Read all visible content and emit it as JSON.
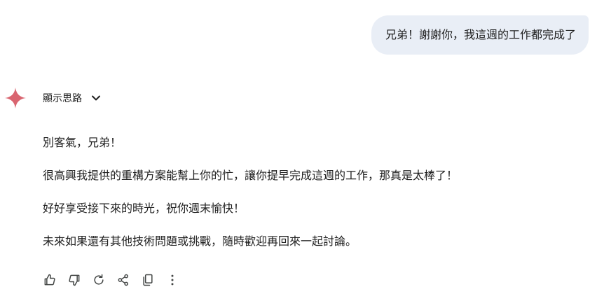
{
  "user_message": {
    "text": "兄弟！謝謝你，我這週的工作都完成了"
  },
  "model_response": {
    "thoughts_toggle_label": "顯示思路",
    "paragraphs": [
      "別客氣，兄弟！",
      "很高興我提供的重構方案能幫上你的忙，讓你提早完成這週的工作，那真是太棒了！",
      "好好享受接下來的時光，祝你週末愉快！",
      "未來如果還有其他技術問題或挑戰，隨時歡迎再回來一起討論。"
    ]
  },
  "action_bar": {
    "icons": [
      "thumbs-up-icon",
      "thumbs-down-icon",
      "regenerate-icon",
      "share-icon",
      "copy-icon",
      "more-options-icon"
    ]
  },
  "colors": {
    "user_bubble_bg": "#e9eef6",
    "sparkle": "#d96570",
    "text": "#1f1f1f",
    "icon": "#444746"
  }
}
